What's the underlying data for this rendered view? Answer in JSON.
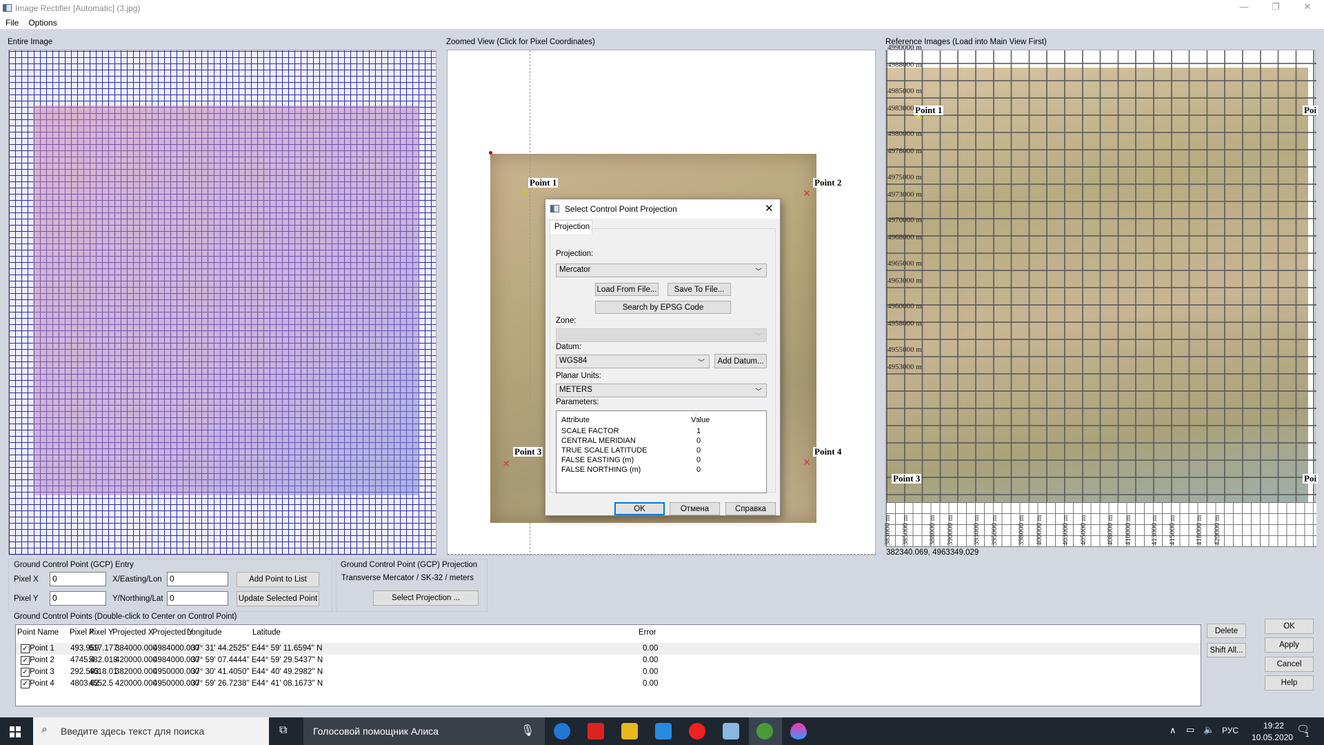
{
  "window": {
    "title": "Image Rectifier [Automatic] (3.jpg)",
    "minimize": "—",
    "restore": "❐",
    "close": "✕"
  },
  "menu": [
    "File",
    "Options"
  ],
  "panels": {
    "entire": "Entire Image",
    "zoomed": "Zoomed View (Click for Pixel Coordinates)",
    "reference": "Reference Images (Load into Main View First)"
  },
  "zoomed_points": [
    "Point 1",
    "Point 2",
    "Point 3",
    "Point 4"
  ],
  "reference": {
    "point_labels": [
      "Point 1",
      "Poi",
      "Point 3",
      "Poi"
    ],
    "y_ticks": [
      "4990000 m",
      "4988000 m",
      "4985000 m",
      "4983000 m",
      "4980000 m",
      "4978000 m",
      "4975000 m",
      "4973000 m",
      "4970000 m",
      "4968000 m",
      "4965000 m",
      "4963000 m",
      "4960000 m",
      "4958000 m",
      "4955000 m",
      "4953000 m"
    ],
    "y_tick_values": [
      4990000,
      4988000,
      4985000,
      4983000,
      4980000,
      4978000,
      4975000,
      4973000,
      4970000,
      4968000,
      4965000,
      4963000,
      4960000,
      4958000,
      4955000,
      4953000
    ],
    "x_ticks": [
      "383000 m",
      "385000 m",
      "388000 m",
      "390000 m",
      "393000 m",
      "395000 m",
      "398000 m",
      "400000 m",
      "403000 m",
      "405000 m",
      "408000 m",
      "410000 m",
      "413000 m",
      "415000 m",
      "418000 m",
      "420000 m"
    ],
    "x_tick_values": [
      383000,
      385000,
      388000,
      390000,
      393000,
      395000,
      398000,
      400000,
      403000,
      405000,
      408000,
      410000,
      413000,
      415000,
      418000,
      420000
    ],
    "cursor_coords": "382340.069, 4963349.029"
  },
  "gcp_entry": {
    "title": "Ground Control Point (GCP) Entry",
    "pixel_x_label": "Pixel X",
    "pixel_x": "0",
    "pixel_y_label": "Pixel Y",
    "pixel_y": "0",
    "easting_label": "X/Easting/Lon",
    "easting": "0",
    "northing_label": "Y/Northing/Lat",
    "northing": "0",
    "add_button": "Add Point to List",
    "update_button": "Update Selected Point"
  },
  "gcp_projection": {
    "title": "Ground Control Point (GCP) Projection",
    "value": "Transverse Mercator / SK-32 / meters",
    "select_button": "Select Projection ..."
  },
  "gcp_list": {
    "title": "Ground Control Points (Double-click to Center on Control Point)",
    "columns": [
      "Point Name",
      "Pixel X",
      "Pixel Y",
      "Projected X",
      "Projected Y",
      "Longitude",
      "Latitude",
      "Error"
    ],
    "rows": [
      {
        "checked": true,
        "cells": [
          "Point 1",
          "493.959",
          "617.177",
          "384000.000",
          "4984000.000",
          "37° 31' 44.2525'' E",
          "44° 59' 11.6594'' N",
          "0.00"
        ]
      },
      {
        "checked": true,
        "cells": [
          "Point 2",
          "4745.4",
          "582.018",
          "420000.000",
          "4984000.000",
          "37° 59' 07.4444'' E",
          "44° 59' 29.5437'' N",
          "0.00"
        ]
      },
      {
        "checked": true,
        "cells": [
          "Point 3",
          "292.593",
          "4618.01",
          "382000.000",
          "4950000.000",
          "37° 30' 41.4050'' E",
          "44° 40' 49.2982'' N",
          "0.00"
        ]
      },
      {
        "checked": true,
        "cells": [
          "Point 4",
          "4803.62",
          "4552.5",
          "420000.000",
          "4950000.000",
          "37° 59' 26.7238'' E",
          "44° 41' 08.1673'' N",
          "0.00"
        ]
      }
    ],
    "delete_button": "Delete",
    "shift_button": "Shift All..."
  },
  "actions": {
    "ok": "OK",
    "apply": "Apply",
    "cancel": "Cancel",
    "help": "Help"
  },
  "dialog": {
    "title": "Select Control Point Projection",
    "tab": "Projection",
    "projection_label": "Projection:",
    "projection": "Mercator",
    "load_button": "Load From File...",
    "save_button": "Save To File...",
    "epsg_button": "Search by EPSG Code",
    "zone_label": "Zone:",
    "zone": "",
    "datum_label": "Datum:",
    "datum": "WGS84",
    "add_datum_button": "Add Datum...",
    "units_label": "Planar Units:",
    "units": "METERS",
    "params_label": "Parameters:",
    "param_cols": [
      "Attribute",
      "Value"
    ],
    "params": [
      [
        "SCALE FACTOR",
        "1"
      ],
      [
        "CENTRAL MERIDIAN",
        "0"
      ],
      [
        "TRUE SCALE LATITUDE",
        "0"
      ],
      [
        "FALSE EASTING (m)",
        "0"
      ],
      [
        "FALSE NORTHING (m)",
        "0"
      ]
    ],
    "ok": "OK",
    "cancel": "Отмена",
    "help": "Справка"
  },
  "taskbar": {
    "search_placeholder": "Введите здесь текст для поиска",
    "assistant": "Голосовой помощник Алиса",
    "lang": "РУС",
    "time": "19:22",
    "date": "10.05.2020",
    "notifications": "1"
  }
}
